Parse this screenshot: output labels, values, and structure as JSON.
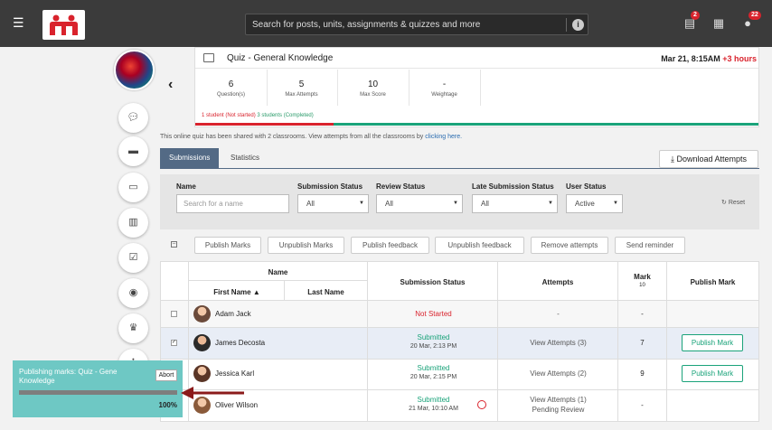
{
  "topbar": {
    "search_placeholder": "Search for posts, units, assignments & quizzes and more",
    "badges": {
      "tasks": "2",
      "notifications": "22"
    }
  },
  "quiz": {
    "title": "Quiz - General Knowledge",
    "date": "Mar 21, 8:15AM",
    "date_extra": "+3 hours",
    "stats": [
      {
        "value": "6",
        "label": "Question(s)"
      },
      {
        "value": "5",
        "label": "Max Attempts"
      },
      {
        "value": "10",
        "label": "Max Score"
      },
      {
        "value": "-",
        "label": "Weightage"
      }
    ],
    "foot_not_started": "1 student (Not started)",
    "foot_completed": "3 students (Completed)"
  },
  "shared": {
    "text": "This online quiz has been shared with 2 classrooms. View attempts from all the classrooms by ",
    "link": "clicking here."
  },
  "tabs": {
    "submissions": "Submissions",
    "statistics": "Statistics"
  },
  "download_label": "Download Attempts",
  "filters": {
    "name_label": "Name",
    "name_placeholder": "Search for a name",
    "submission_label": "Submission Status",
    "submission_value": "All",
    "review_label": "Review Status",
    "review_value": "All",
    "late_label": "Late Submission Status",
    "late_value": "All",
    "user_label": "User Status",
    "user_value": "Active",
    "reset": "Reset"
  },
  "actions": [
    "Publish Marks",
    "Unpublish Marks",
    "Publish feedback",
    "Unpublish feedback",
    "Remove attempts",
    "Send reminder"
  ],
  "table": {
    "name_header": "Name",
    "first_name": "First Name ▲",
    "last_name": "Last Name",
    "submission_status": "Submission Status",
    "attempts": "Attempts",
    "mark": "Mark",
    "mark_sub": "10",
    "publish_mark": "Publish Mark",
    "rows": [
      {
        "name": "Adam Jack",
        "status": "Not Started",
        "date": "",
        "attempts": "-",
        "attempts2": "",
        "mark": "-",
        "publish": ""
      },
      {
        "name": "James Decosta",
        "status": "Submitted",
        "date": "20 Mar, 2:13 PM",
        "attempts": "View Attempts (3)",
        "attempts2": "",
        "mark": "7",
        "publish": "Publish Mark"
      },
      {
        "name": "Jessica Karl",
        "status": "Submitted",
        "date": "20 Mar, 2:15 PM",
        "attempts": "View Attempts (2)",
        "attempts2": "",
        "mark": "9",
        "publish": "Publish Mark"
      },
      {
        "name": "Oliver Wilson",
        "status": "Submitted",
        "date": "21 Mar, 10:10 AM",
        "attempts": "View Attempts (1)",
        "attempts2": "Pending Review",
        "mark": "-",
        "publish": ""
      }
    ]
  },
  "toast": {
    "text": "Publishing marks: Quiz - General Knowledge",
    "text_line1": "Publishing marks: Quiz - Gene",
    "text_line2": "Knowledge",
    "abort": "Abort",
    "progress": 1.0,
    "percent": "100%"
  },
  "colors": {
    "accent": "#536a85",
    "green": "#1aa37a",
    "red": "#d9232d",
    "toast": "#6ec8c4"
  }
}
